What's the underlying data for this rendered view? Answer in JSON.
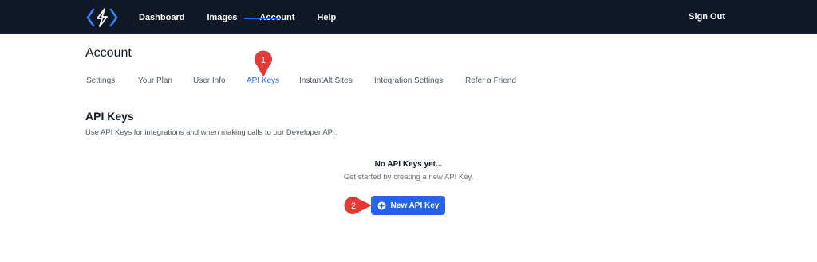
{
  "header": {
    "nav": [
      "Dashboard",
      "Images",
      "Account",
      "Help"
    ],
    "sign_out": "Sign Out"
  },
  "account": {
    "title": "Account",
    "tabs": [
      {
        "label": "Settings"
      },
      {
        "label": "Your Plan"
      },
      {
        "label": "User Info"
      },
      {
        "label": "API Keys",
        "active": true
      },
      {
        "label": "InstantAlt Sites"
      },
      {
        "label": "Integration Settings"
      },
      {
        "label": "Refer a Friend"
      }
    ]
  },
  "api_keys": {
    "title": "API Keys",
    "description": "Use API Keys for integrations and when making calls to our Developer API.",
    "empty_title": "No API Keys yet...",
    "empty_description": "Get started by creating a new API Key.",
    "new_button": "New API Key"
  },
  "annotations": [
    {
      "number": "1"
    },
    {
      "number": "2"
    }
  ],
  "colors": {
    "header_bg": "#111827",
    "accent": "#2563eb",
    "marker": "#e53935"
  }
}
